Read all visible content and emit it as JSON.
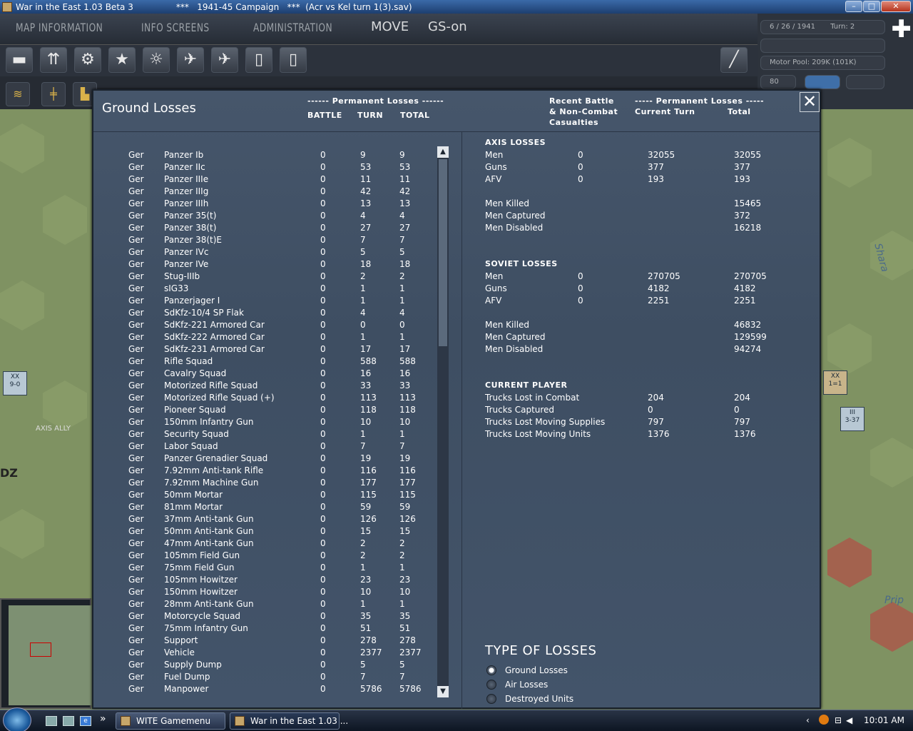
{
  "window": {
    "title": "War in the East 1.03 Beta 3",
    "subtitle": "***   1941-45 Campaign   ***  (Acr vs Kel turn 1(3).sav)",
    "min": "–",
    "max": "□",
    "close": "✕"
  },
  "menu": {
    "tabs": [
      "MAP INFORMATION",
      "INFO SCREENS",
      "ADMINISTRATION"
    ],
    "mode": "MOVE",
    "gs": "GS-on"
  },
  "status": {
    "date": "6 / 26 / 1941",
    "turn": "Turn: 2",
    "motor_pool": "Motor Pool:  209K (101K)",
    "zoom": "80"
  },
  "map_labels": {
    "axis_ally": "AXIS ALLY",
    "river": "Shara",
    "river2": "Prip",
    "dz": "DZ",
    "unit1": "9-0",
    "unit2": "1=1",
    "unit3": "3-37"
  },
  "dialog": {
    "title": "Ground Losses",
    "perm_losses_hdr": "------ Permanent Losses ------",
    "col_battle": "BATTLE",
    "col_turn": "TURN",
    "col_total": "TOTAL",
    "recent_hdr": "Recent Battle\n& Non-Combat\nCasualties",
    "perm2_hdr": "----- Permanent Losses -----",
    "cur_turn_hdr": "Current Turn",
    "total_hdr": "Total",
    "close": "✕"
  },
  "losses": [
    {
      "nat": "Ger",
      "name": "Panzer Ib",
      "battle": "0",
      "turn": "9",
      "total": "9"
    },
    {
      "nat": "Ger",
      "name": "Panzer IIc",
      "battle": "0",
      "turn": "53",
      "total": "53"
    },
    {
      "nat": "Ger",
      "name": "Panzer IIIe",
      "battle": "0",
      "turn": "11",
      "total": "11"
    },
    {
      "nat": "Ger",
      "name": "Panzer IIIg",
      "battle": "0",
      "turn": "42",
      "total": "42"
    },
    {
      "nat": "Ger",
      "name": "Panzer IIIh",
      "battle": "0",
      "turn": "13",
      "total": "13"
    },
    {
      "nat": "Ger",
      "name": "Panzer 35(t)",
      "battle": "0",
      "turn": "4",
      "total": "4"
    },
    {
      "nat": "Ger",
      "name": "Panzer 38(t)",
      "battle": "0",
      "turn": "27",
      "total": "27"
    },
    {
      "nat": "Ger",
      "name": "Panzer 38(t)E",
      "battle": "0",
      "turn": "7",
      "total": "7"
    },
    {
      "nat": "Ger",
      "name": "Panzer IVc",
      "battle": "0",
      "turn": "5",
      "total": "5"
    },
    {
      "nat": "Ger",
      "name": "Panzer IVe",
      "battle": "0",
      "turn": "18",
      "total": "18"
    },
    {
      "nat": "Ger",
      "name": "Stug-IIIb",
      "battle": "0",
      "turn": "2",
      "total": "2"
    },
    {
      "nat": "Ger",
      "name": "sIG33",
      "battle": "0",
      "turn": "1",
      "total": "1"
    },
    {
      "nat": "Ger",
      "name": "Panzerjager I",
      "battle": "0",
      "turn": "1",
      "total": "1"
    },
    {
      "nat": "Ger",
      "name": "SdKfz-10/4 SP Flak",
      "battle": "0",
      "turn": "4",
      "total": "4"
    },
    {
      "nat": "Ger",
      "name": "SdKfz-221 Armored Car",
      "battle": "0",
      "turn": "0",
      "total": "0"
    },
    {
      "nat": "Ger",
      "name": "SdKfz-222 Armored Car",
      "battle": "0",
      "turn": "1",
      "total": "1"
    },
    {
      "nat": "Ger",
      "name": "SdKfz-231 Armored Car",
      "battle": "0",
      "turn": "17",
      "total": "17"
    },
    {
      "nat": "Ger",
      "name": "Rifle Squad",
      "battle": "0",
      "turn": "588",
      "total": "588"
    },
    {
      "nat": "Ger",
      "name": "Cavalry Squad",
      "battle": "0",
      "turn": "16",
      "total": "16"
    },
    {
      "nat": "Ger",
      "name": "Motorized Rifle Squad",
      "battle": "0",
      "turn": "33",
      "total": "33"
    },
    {
      "nat": "Ger",
      "name": "Motorized Rifle Squad (+)",
      "battle": "0",
      "turn": "113",
      "total": "113"
    },
    {
      "nat": "Ger",
      "name": "Pioneer Squad",
      "battle": "0",
      "turn": "118",
      "total": "118"
    },
    {
      "nat": "Ger",
      "name": "150mm Infantry Gun",
      "battle": "0",
      "turn": "10",
      "total": "10"
    },
    {
      "nat": "Ger",
      "name": "Security Squad",
      "battle": "0",
      "turn": "1",
      "total": "1"
    },
    {
      "nat": "Ger",
      "name": "Labor Squad",
      "battle": "0",
      "turn": "7",
      "total": "7"
    },
    {
      "nat": "Ger",
      "name": "Panzer Grenadier Squad",
      "battle": "0",
      "turn": "19",
      "total": "19"
    },
    {
      "nat": "Ger",
      "name": "7.92mm Anti-tank Rifle",
      "battle": "0",
      "turn": "116",
      "total": "116"
    },
    {
      "nat": "Ger",
      "name": "7.92mm Machine Gun",
      "battle": "0",
      "turn": "177",
      "total": "177"
    },
    {
      "nat": "Ger",
      "name": "50mm Mortar",
      "battle": "0",
      "turn": "115",
      "total": "115"
    },
    {
      "nat": "Ger",
      "name": "81mm Mortar",
      "battle": "0",
      "turn": "59",
      "total": "59"
    },
    {
      "nat": "Ger",
      "name": "37mm Anti-tank Gun",
      "battle": "0",
      "turn": "126",
      "total": "126"
    },
    {
      "nat": "Ger",
      "name": "50mm Anti-tank Gun",
      "battle": "0",
      "turn": "15",
      "total": "15"
    },
    {
      "nat": "Ger",
      "name": "47mm Anti-tank Gun",
      "battle": "0",
      "turn": "2",
      "total": "2"
    },
    {
      "nat": "Ger",
      "name": "105mm Field Gun",
      "battle": "0",
      "turn": "2",
      "total": "2"
    },
    {
      "nat": "Ger",
      "name": "75mm Field Gun",
      "battle": "0",
      "turn": "1",
      "total": "1"
    },
    {
      "nat": "Ger",
      "name": "105mm Howitzer",
      "battle": "0",
      "turn": "23",
      "total": "23"
    },
    {
      "nat": "Ger",
      "name": "150mm Howitzer",
      "battle": "0",
      "turn": "10",
      "total": "10"
    },
    {
      "nat": "Ger",
      "name": "28mm Anti-tank Gun",
      "battle": "0",
      "turn": "1",
      "total": "1"
    },
    {
      "nat": "Ger",
      "name": "Motorcycle Squad",
      "battle": "0",
      "turn": "35",
      "total": "35"
    },
    {
      "nat": "Ger",
      "name": "75mm Infantry Gun",
      "battle": "0",
      "turn": "51",
      "total": "51"
    },
    {
      "nat": "Ger",
      "name": "Support",
      "battle": "0",
      "turn": "278",
      "total": "278"
    },
    {
      "nat": "Ger",
      "name": "Vehicle",
      "battle": "0",
      "turn": "2377",
      "total": "2377"
    },
    {
      "nat": "Ger",
      "name": "Supply Dump",
      "battle": "0",
      "turn": "5",
      "total": "5"
    },
    {
      "nat": "Ger",
      "name": "Fuel Dump",
      "battle": "0",
      "turn": "7",
      "total": "7"
    },
    {
      "nat": "Ger",
      "name": "Manpower",
      "battle": "0",
      "turn": "5786",
      "total": "5786"
    }
  ],
  "summary": {
    "axis_title": "AXIS LOSSES",
    "axis": [
      {
        "label": "Men",
        "recent": "0",
        "cur": "32055",
        "total": "32055"
      },
      {
        "label": "Guns",
        "recent": "0",
        "cur": "377",
        "total": "377"
      },
      {
        "label": "AFV",
        "recent": "0",
        "cur": "193",
        "total": "193"
      }
    ],
    "axis_detail": [
      {
        "label": "Men Killed",
        "total": "15465"
      },
      {
        "label": "Men Captured",
        "total": "372"
      },
      {
        "label": "Men Disabled",
        "total": "16218"
      }
    ],
    "soviet_title": "SOVIET LOSSES",
    "soviet": [
      {
        "label": "Men",
        "recent": "0",
        "cur": "270705",
        "total": "270705"
      },
      {
        "label": "Guns",
        "recent": "0",
        "cur": "4182",
        "total": "4182"
      },
      {
        "label": "AFV",
        "recent": "0",
        "cur": "2251",
        "total": "2251"
      }
    ],
    "soviet_detail": [
      {
        "label": "Men Killed",
        "total": "46832"
      },
      {
        "label": "Men Captured",
        "total": "129599"
      },
      {
        "label": "Men Disabled",
        "total": "94274"
      }
    ],
    "player_title": "CURRENT PLAYER",
    "player": [
      {
        "label": "Trucks Lost in Combat",
        "cur": "204",
        "total": "204"
      },
      {
        "label": "Trucks Captured",
        "cur": "0",
        "total": "0"
      },
      {
        "label": "Trucks Lost Moving Supplies",
        "cur": "797",
        "total": "797"
      },
      {
        "label": "Trucks Lost Moving Units",
        "cur": "1376",
        "total": "1376"
      }
    ]
  },
  "type_of_losses": {
    "title": "TYPE OF LOSSES",
    "options": [
      "Ground Losses",
      "Air Losses",
      "Destroyed Units"
    ],
    "selected": "Ground Losses"
  },
  "taskbar": {
    "tasks": [
      "WITE Gamemenu",
      "War in the East 1.03 ..."
    ],
    "clock": "10:01 AM",
    "chevron": "»"
  }
}
